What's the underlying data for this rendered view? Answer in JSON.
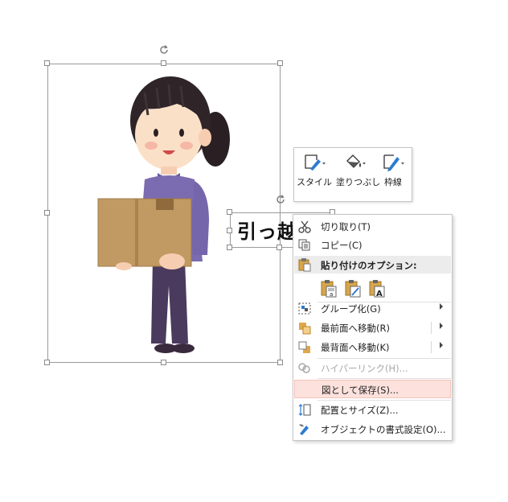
{
  "textbox": {
    "text": "引っ越"
  },
  "mini_toolbar": {
    "style_label": "スタイル",
    "fill_label": "塗りつぶし",
    "outline_label": "枠線"
  },
  "context_menu": {
    "cut": "切り取り(T)",
    "copy": "コピー(C)",
    "paste_header": "貼り付けのオプション:",
    "group": "グループ化(G)",
    "bring_front": "最前面へ移動(R)",
    "send_back": "最背面へ移動(K)",
    "hyperlink": "ハイパーリンク(H)...",
    "save_as_picture": "図として保存(S)...",
    "size_position": "配置とサイズ(Z)...",
    "format_object": "オブジェクトの書式設定(O)..."
  },
  "colors": {
    "hover_bg": "#fde1dc",
    "shirt": "#7b6bb0",
    "pants": "#4a3a5e",
    "box": "#c19a63"
  }
}
